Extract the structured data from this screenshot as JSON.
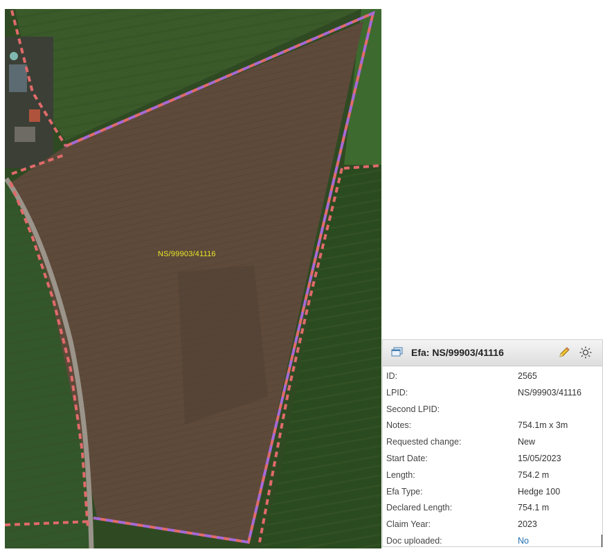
{
  "map": {
    "parcel_label": "NS/99903/41116",
    "colors": {
      "field": "#5e4a3a",
      "grass_dark": "#2e4a22",
      "grass_light": "#3f5e2c",
      "boundary_red": "#e06a6a",
      "boundary_purple": "#a569d6",
      "road": "#9a948a"
    }
  },
  "panel": {
    "title": "Efa: NS/99903/41116",
    "icons": {
      "header": "window-icon",
      "edit": "pencil-icon",
      "settings": "sun-icon"
    },
    "rows": [
      {
        "key": "ID:",
        "value": "2565"
      },
      {
        "key": "LPID:",
        "value": "NS/99903/41116"
      },
      {
        "key": "Second LPID:",
        "value": ""
      },
      {
        "key": "Notes:",
        "value": "754.1m x 3m"
      },
      {
        "key": "Requested change:",
        "value": "New"
      },
      {
        "key": "Start Date:",
        "value": "15/05/2023"
      },
      {
        "key": "Length:",
        "value": "754.2 m"
      },
      {
        "key": "Efa Type:",
        "value": "Hedge 100"
      },
      {
        "key": "Declared Length:",
        "value": "754.1 m"
      },
      {
        "key": "Claim Year:",
        "value": "2023"
      },
      {
        "key": "Doc uploaded:",
        "value": "No"
      }
    ]
  }
}
